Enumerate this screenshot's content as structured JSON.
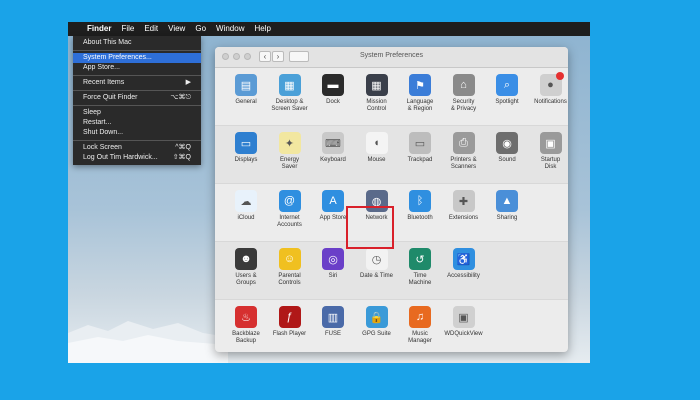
{
  "menubar": {
    "apple_glyph": "",
    "items": [
      "Finder",
      "File",
      "Edit",
      "View",
      "Go",
      "Window",
      "Help"
    ]
  },
  "apple_menu": {
    "items": [
      {
        "label": "About This Mac",
        "shortcut": ""
      },
      {
        "sep": true
      },
      {
        "label": "System Preferences...",
        "shortcut": "",
        "highlighted": true
      },
      {
        "label": "App Store...",
        "shortcut": ""
      },
      {
        "sep": true
      },
      {
        "label": "Recent Items",
        "shortcut": "▶"
      },
      {
        "sep": true
      },
      {
        "label": "Force Quit Finder",
        "shortcut": "⌥⌘⎋"
      },
      {
        "sep": true
      },
      {
        "label": "Sleep",
        "shortcut": ""
      },
      {
        "label": "Restart...",
        "shortcut": ""
      },
      {
        "label": "Shut Down...",
        "shortcut": ""
      },
      {
        "sep": true
      },
      {
        "label": "Lock Screen",
        "shortcut": "^⌘Q"
      },
      {
        "label": "Log Out Tim Hardwick...",
        "shortcut": "⇧⌘Q"
      }
    ]
  },
  "window": {
    "title": "System Preferences",
    "back_glyph": "‹",
    "forward_glyph": "›"
  },
  "rows": [
    [
      {
        "label": "General",
        "icon": "general-icon",
        "color": "#5b9bd5"
      },
      {
        "label": "Desktop &\nScreen Saver",
        "icon": "desktop-screen-saver-icon",
        "color": "#4aa0d8"
      },
      {
        "label": "Dock",
        "icon": "dock-icon",
        "color": "#2b2b2b"
      },
      {
        "label": "Mission\nControl",
        "icon": "mission-control-icon",
        "color": "#3a3f4a"
      },
      {
        "label": "Language\n& Region",
        "icon": "language-region-icon",
        "color": "#3b7dd8"
      },
      {
        "label": "Security\n& Privacy",
        "icon": "security-privacy-icon",
        "color": "#8a8a8a"
      },
      {
        "label": "Spotlight",
        "icon": "spotlight-icon",
        "color": "#3a8ee6"
      },
      {
        "label": "Notifications",
        "icon": "notifications-icon",
        "color": "#cfcfcf"
      }
    ],
    [
      {
        "label": "Displays",
        "icon": "displays-icon",
        "color": "#2e7fd0"
      },
      {
        "label": "Energy\nSaver",
        "icon": "energy-saver-icon",
        "color": "#f2e7a0"
      },
      {
        "label": "Keyboard",
        "icon": "keyboard-icon",
        "color": "#c9c9c9"
      },
      {
        "label": "Mouse",
        "icon": "mouse-icon",
        "color": "#f4f4f4"
      },
      {
        "label": "Trackpad",
        "icon": "trackpad-icon",
        "color": "#bdbdbd"
      },
      {
        "label": "Printers &\nScanners",
        "icon": "printers-scanners-icon",
        "color": "#9a9a9a"
      },
      {
        "label": "Sound",
        "icon": "sound-icon",
        "color": "#6e6e6e"
      },
      {
        "label": "Startup\nDisk",
        "icon": "startup-disk-icon",
        "color": "#9a9a9a"
      }
    ],
    [
      {
        "label": "iCloud",
        "icon": "icloud-icon",
        "color": "#e8f2fb"
      },
      {
        "label": "Internet\nAccounts",
        "icon": "internet-accounts-icon",
        "color": "#2f8fe0"
      },
      {
        "label": "App Store",
        "icon": "app-store-icon",
        "color": "#2f8fe0"
      },
      {
        "label": "Network",
        "icon": "network-icon",
        "color": "#5a6a8a"
      },
      {
        "label": "Bluetooth",
        "icon": "bluetooth-icon",
        "color": "#2f8fe0"
      },
      {
        "label": "Extensions",
        "icon": "extensions-icon",
        "color": "#c8c8c8"
      },
      {
        "label": "Sharing",
        "icon": "sharing-icon",
        "color": "#4a8fd8"
      }
    ],
    [
      {
        "label": "Users &\nGroups",
        "icon": "users-groups-icon",
        "color": "#3a3a3a"
      },
      {
        "label": "Parental\nControls",
        "icon": "parental-controls-icon",
        "color": "#f0c020"
      },
      {
        "label": "Siri",
        "icon": "siri-icon",
        "color": "#6a3fc8"
      },
      {
        "label": "Date & Time",
        "icon": "date-time-icon",
        "color": "#f2f2f2"
      },
      {
        "label": "Time\nMachine",
        "icon": "time-machine-icon",
        "color": "#1f8a6a"
      },
      {
        "label": "Accessibility",
        "icon": "accessibility-icon",
        "color": "#2f8fe0"
      }
    ],
    [
      {
        "label": "Backblaze\nBackup",
        "icon": "backblaze-icon",
        "color": "#d63030"
      },
      {
        "label": "Flash Player",
        "icon": "flash-player-icon",
        "color": "#b01818"
      },
      {
        "label": "FUSE",
        "icon": "fuse-icon",
        "color": "#4a6aa8"
      },
      {
        "label": "GPG Suite",
        "icon": "gpg-suite-icon",
        "color": "#3a9ad8"
      },
      {
        "label": "Music\nManager",
        "icon": "music-manager-icon",
        "color": "#e86a20"
      },
      {
        "label": "WDQuickView",
        "icon": "wdquickview-icon",
        "color": "#d0d0d0"
      }
    ]
  ]
}
